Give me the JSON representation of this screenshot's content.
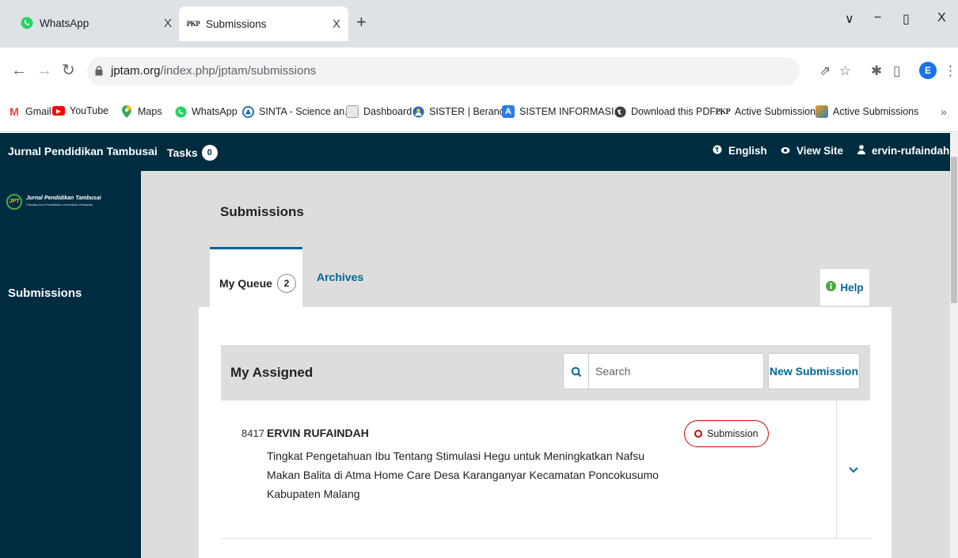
{
  "browser": {
    "tabs": [
      {
        "title": "WhatsApp",
        "icon": "whatsapp-icon",
        "close": "X"
      },
      {
        "title": "Submissions",
        "favicon_text": "PKP",
        "close": "X",
        "active": true
      }
    ],
    "new_tab": "+",
    "window_controls": [
      "∨",
      "−",
      "▯",
      "X"
    ],
    "url_domain": "jptam.org",
    "url_path": "/index.php/jptam/submissions",
    "profile_initial": "E",
    "bookmarks": [
      {
        "label": "Gmail",
        "icon": "gmail-icon",
        "icon_text": "M"
      },
      {
        "label": "YouTube",
        "icon": "youtube-icon",
        "icon_text": "▶"
      },
      {
        "label": "Maps",
        "icon": "maps-icon",
        "icon_text": ""
      },
      {
        "label": "WhatsApp",
        "icon": "whatsapp-icon",
        "icon_text": ""
      },
      {
        "label": "SINTA - Science an...",
        "icon": "sinta-icon",
        "icon_text": ""
      },
      {
        "label": "Dashboard",
        "icon": "dashboard-icon",
        "icon_text": ""
      },
      {
        "label": "SISTER | Beranda",
        "icon": "sister-icon",
        "icon_text": ""
      },
      {
        "label": "SISTEM INFORMASI...",
        "icon": "sistem-icon",
        "icon_text": "A"
      },
      {
        "label": "Download this PDF...",
        "icon": "download-icon",
        "icon_text": ""
      },
      {
        "label": "Active Submissions",
        "icon": "pkp-icon",
        "icon_text": "PKP"
      },
      {
        "label": "Active Submissions",
        "icon": "ojs-icon",
        "icon_text": ""
      }
    ],
    "bookmarks_more": "»"
  },
  "header": {
    "site_name": "Jurnal Pendidikan Tambusai",
    "tasks_label": "Tasks",
    "tasks_count": "0",
    "language": "English",
    "view_site": "View Site",
    "user": "ervin-rufaindah"
  },
  "sidebar": {
    "logo_title": "Jurnal Pendidikan Tambusai",
    "logo_sub": "Fakultas Ilmu Pendidikan Universitas Pahlawan",
    "active_item": "Submissions"
  },
  "main": {
    "title": "Submissions",
    "tabs": [
      {
        "label": "My Queue",
        "count": "2"
      },
      {
        "label": "Archives"
      }
    ],
    "help": "Help",
    "list": {
      "title": "My Assigned",
      "search_placeholder": "Search",
      "new_submission": "New Submission",
      "items": [
        {
          "id": "8417",
          "author": "ERVIN RUFAINDAH",
          "title": "Tingkat Pengetahuan Ibu Tentang Stimulasi Hegu untuk Meningkatkan Nafsu Makan Balita di Atma Home Care Desa Karanganyar Kecamatan Poncokusumo Kabupaten Malang",
          "stage": "Submission"
        }
      ]
    }
  },
  "colors": {
    "header_bg": "#002c40",
    "link": "#006798",
    "stage_red": "#d00000",
    "logo_green": "#49a942"
  }
}
